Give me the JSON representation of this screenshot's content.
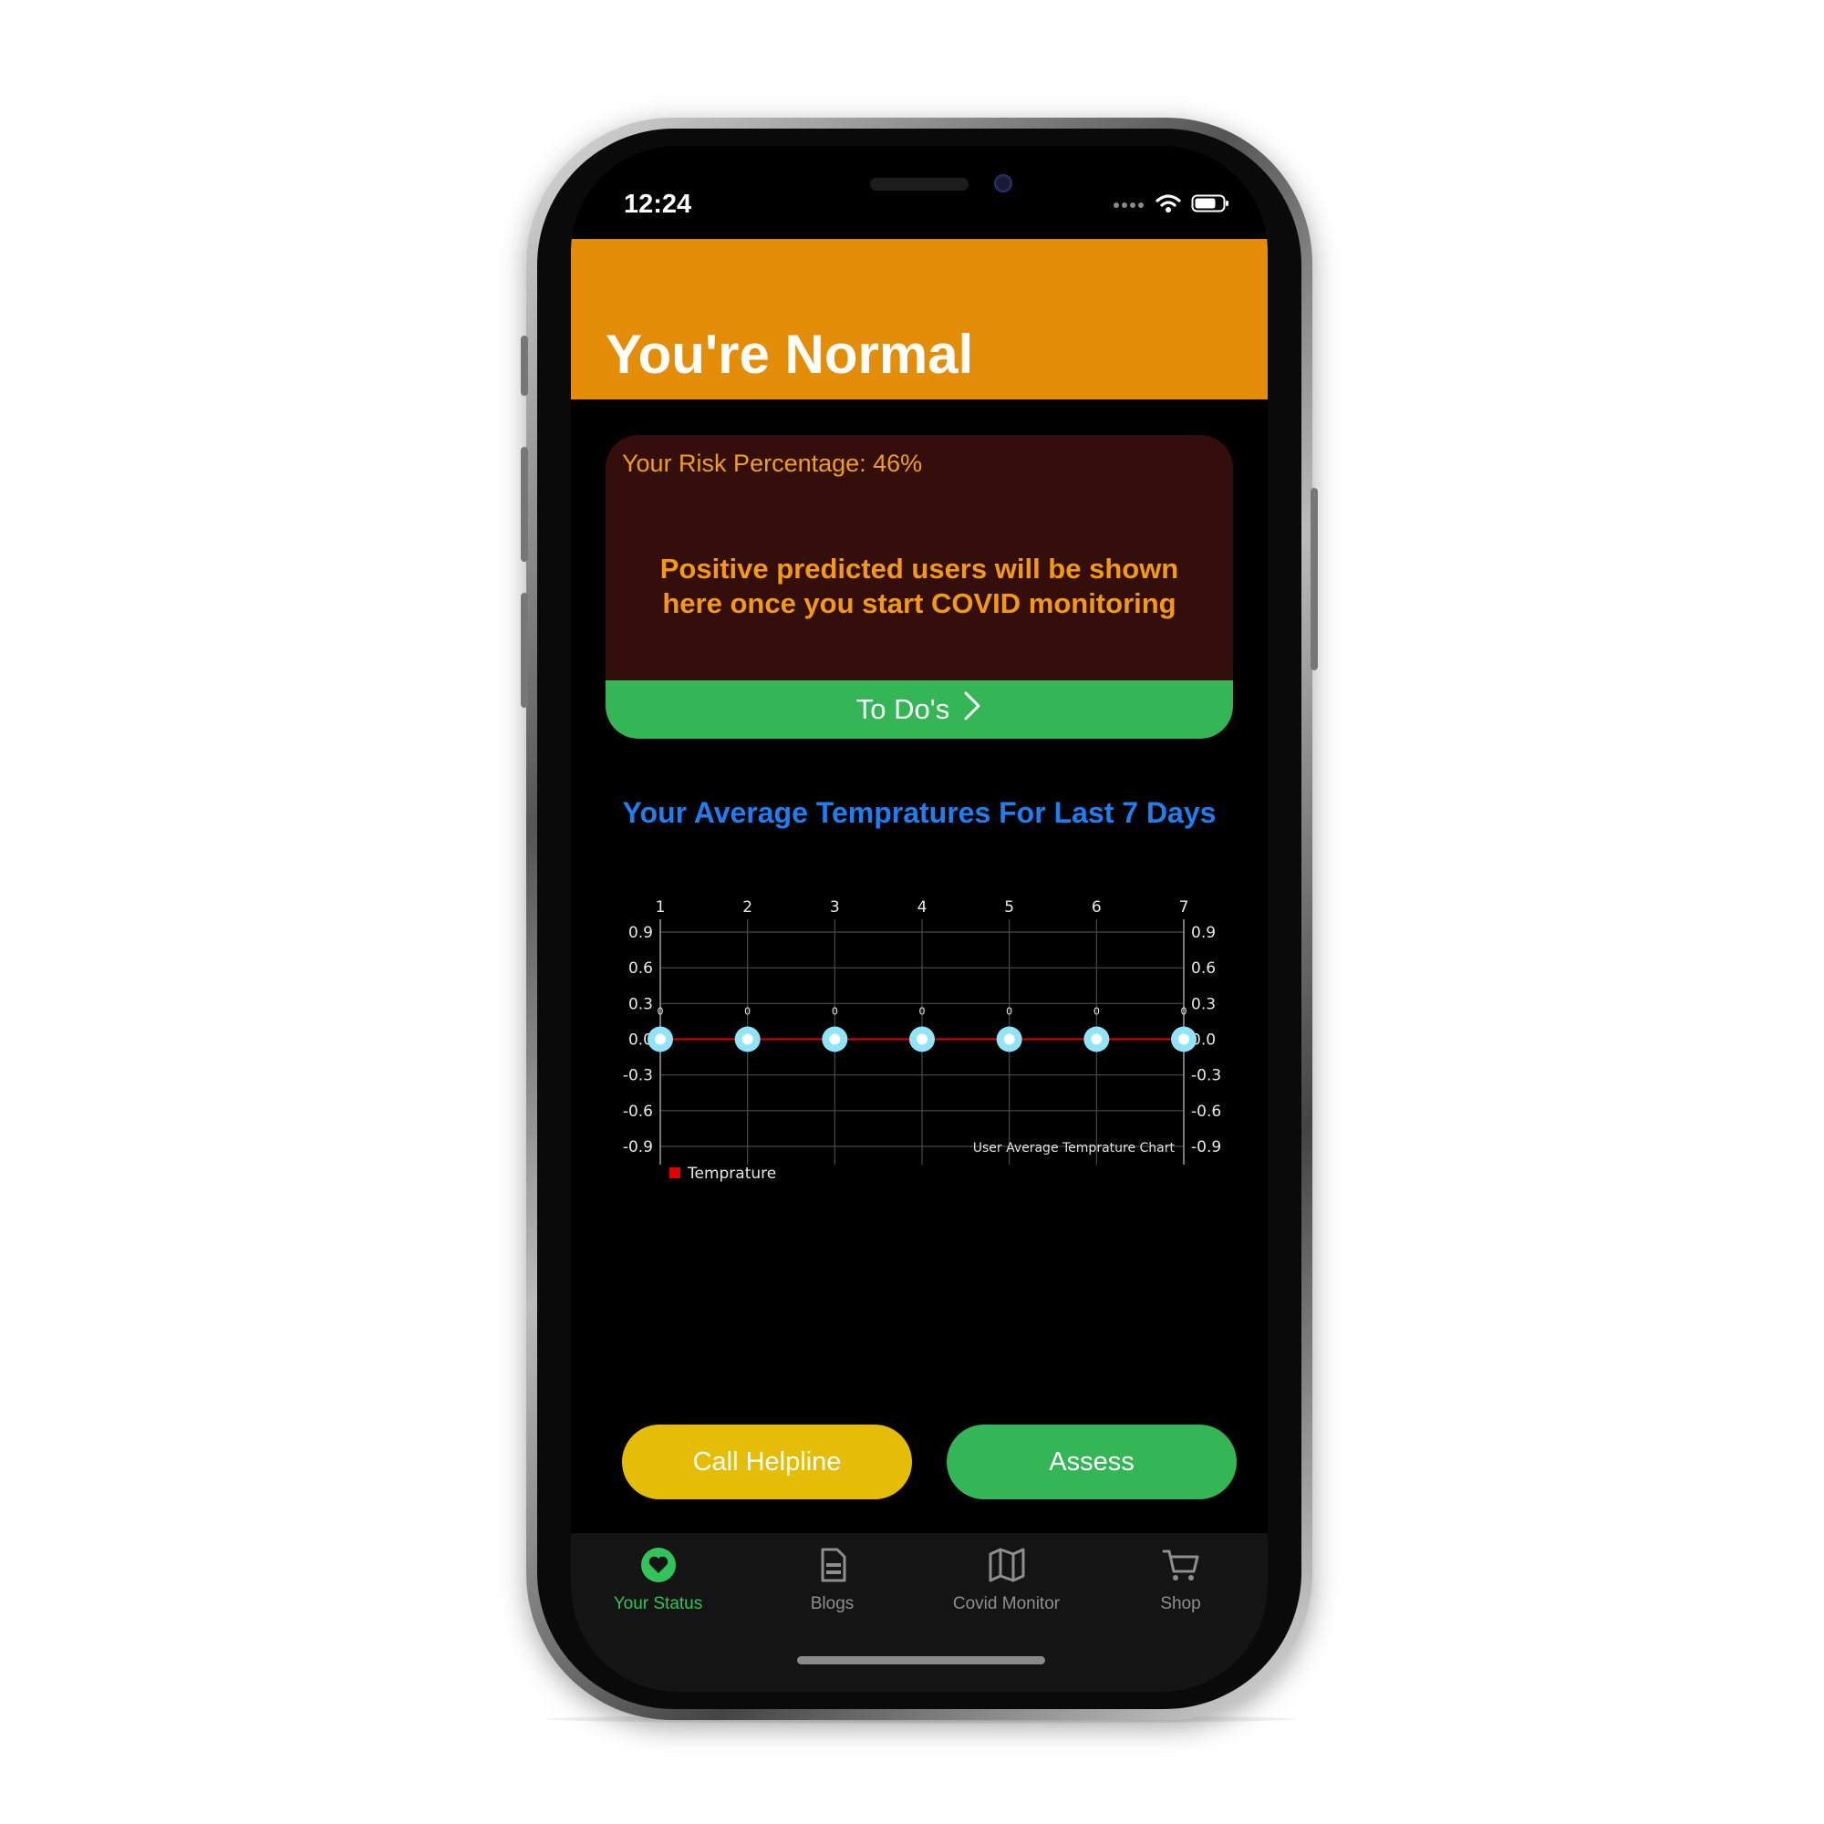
{
  "status_bar": {
    "time": "12:24"
  },
  "header": {
    "title": "You're Normal"
  },
  "risk_card": {
    "risk_text": "Your Risk Percentage: 46%",
    "message": "Positive predicted users will be shown here once you start COVID monitoring",
    "todo_label": "To Do's"
  },
  "chart_heading": "Your Average Tempratures For Last 7 Days",
  "chart_data": {
    "type": "line",
    "x": [
      1,
      2,
      3,
      4,
      5,
      6,
      7
    ],
    "x_tick_labels": [
      "1",
      "2",
      "3",
      "4",
      "5",
      "6",
      "7"
    ],
    "y_tick_labels": [
      "0.9",
      "0.6",
      "0.3",
      "0.0",
      "-0.3",
      "-0.6",
      "-0.9"
    ],
    "ylim": [
      -0.9,
      0.9
    ],
    "series": [
      {
        "name": "Temprature",
        "values": [
          0,
          0,
          0,
          0,
          0,
          0,
          0
        ],
        "color": "#e00000",
        "marker_color": "#8fe4f8"
      }
    ],
    "data_labels": [
      "0",
      "0",
      "0",
      "0",
      "0",
      "0",
      "0"
    ],
    "description": "User Average Temprature Chart",
    "legend": "bottom-left",
    "grid": true
  },
  "buttons": {
    "helpline": "Call Helpline",
    "assess": "Assess"
  },
  "tabs": [
    {
      "label": "Your Status",
      "icon": "heart-icon",
      "active": true
    },
    {
      "label": "Blogs",
      "icon": "document-icon",
      "active": false
    },
    {
      "label": "Covid Monitor",
      "icon": "map-icon",
      "active": false
    },
    {
      "label": "Shop",
      "icon": "cart-icon",
      "active": false
    }
  ],
  "colors": {
    "header": "#e38d09",
    "card": "#330e0b",
    "accent_green": "#34b556",
    "helpline_yellow": "#e6bd06",
    "chart_heading_blue": "#1f7ff0"
  }
}
